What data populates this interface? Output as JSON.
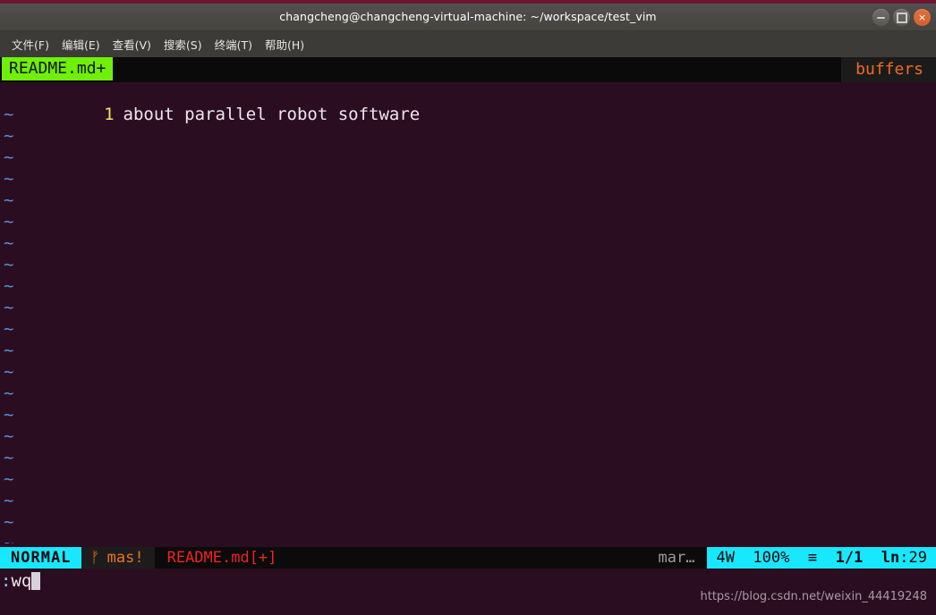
{
  "window": {
    "title": "changcheng@changcheng-virtual-machine: ~/workspace/test_vim",
    "controls": {
      "minimize_label": "minimize",
      "maximize_label": "maximize",
      "close_label": "×"
    }
  },
  "menubar": {
    "items": [
      {
        "label": "文件(F)"
      },
      {
        "label": "编辑(E)"
      },
      {
        "label": "查看(V)"
      },
      {
        "label": "搜索(S)"
      },
      {
        "label": "终端(T)"
      },
      {
        "label": "帮助(H)"
      }
    ]
  },
  "tabline": {
    "active_tab": "README.md+",
    "right_label": "buffers"
  },
  "buffer": {
    "lines": [
      {
        "number": "1",
        "text": "about parallel robot software"
      }
    ],
    "filler": "~",
    "filler_count": 21
  },
  "statusline": {
    "mode": "NORMAL",
    "branch_icon": "ᚠ",
    "branch": "mas!",
    "filename": "README.md[+]",
    "filetype": "mar…",
    "encoding": "4W",
    "percent": "100%",
    "pos_icon": "≡",
    "line_of_total": "1/1",
    "ln_label": "ln",
    "column": ":29"
  },
  "cmdline": {
    "prompt": ":",
    "command": "wq"
  },
  "watermark": {
    "text": "https://blog.csdn.net/weixin_44419248"
  },
  "colors": {
    "editor_bg": "#2b0d21",
    "tab_active_bg": "#6ef00a",
    "tab_right_fg": "#f06b1d",
    "mode_bg": "#18e8ff",
    "branch_fg": "#f07020",
    "filename_fg": "#f02222",
    "linenum_fg": "#f3e35c",
    "tilde_fg": "#5a8fd6",
    "titlebar_bg": "#4b4947",
    "menubar_bg": "#3c3b37",
    "close_btn_bg": "#d2622c"
  }
}
